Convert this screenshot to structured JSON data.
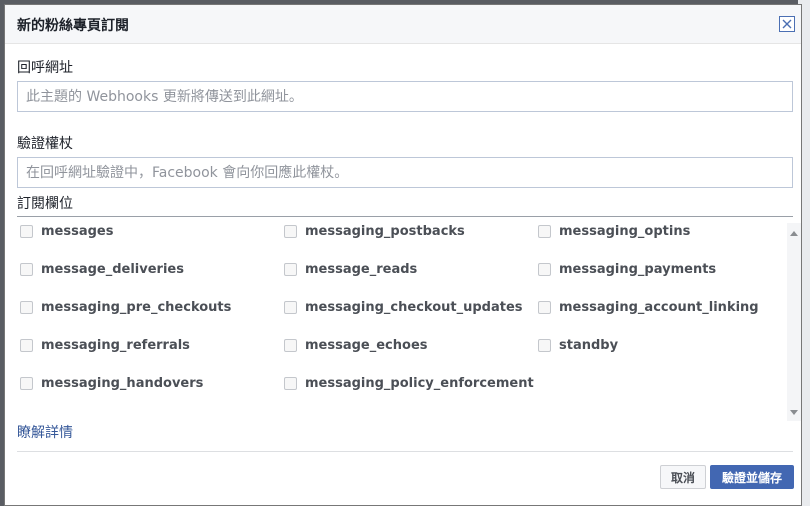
{
  "dialog": {
    "title": "新的粉絲專頁訂閱"
  },
  "callback": {
    "label": "回呼網址",
    "placeholder": "此主題的 Webhooks 更新將傳送到此網址。"
  },
  "verify": {
    "label": "驗證權杖",
    "placeholder": "在回呼網址驗證中，Facebook 會向你回應此權杖。"
  },
  "subscription_fields": {
    "label": "訂閱欄位",
    "columns": [
      [
        "messages",
        "message_deliveries",
        "messaging_pre_checkouts",
        "messaging_referrals",
        "messaging_handovers"
      ],
      [
        "messaging_postbacks",
        "message_reads",
        "messaging_checkout_updates",
        "message_echoes",
        "messaging_policy_enforcement"
      ],
      [
        "messaging_optins",
        "messaging_payments",
        "messaging_account_linking",
        "standby"
      ]
    ]
  },
  "learn_more": "瞭解詳情",
  "buttons": {
    "cancel": "取消",
    "save": "驗證並儲存"
  }
}
